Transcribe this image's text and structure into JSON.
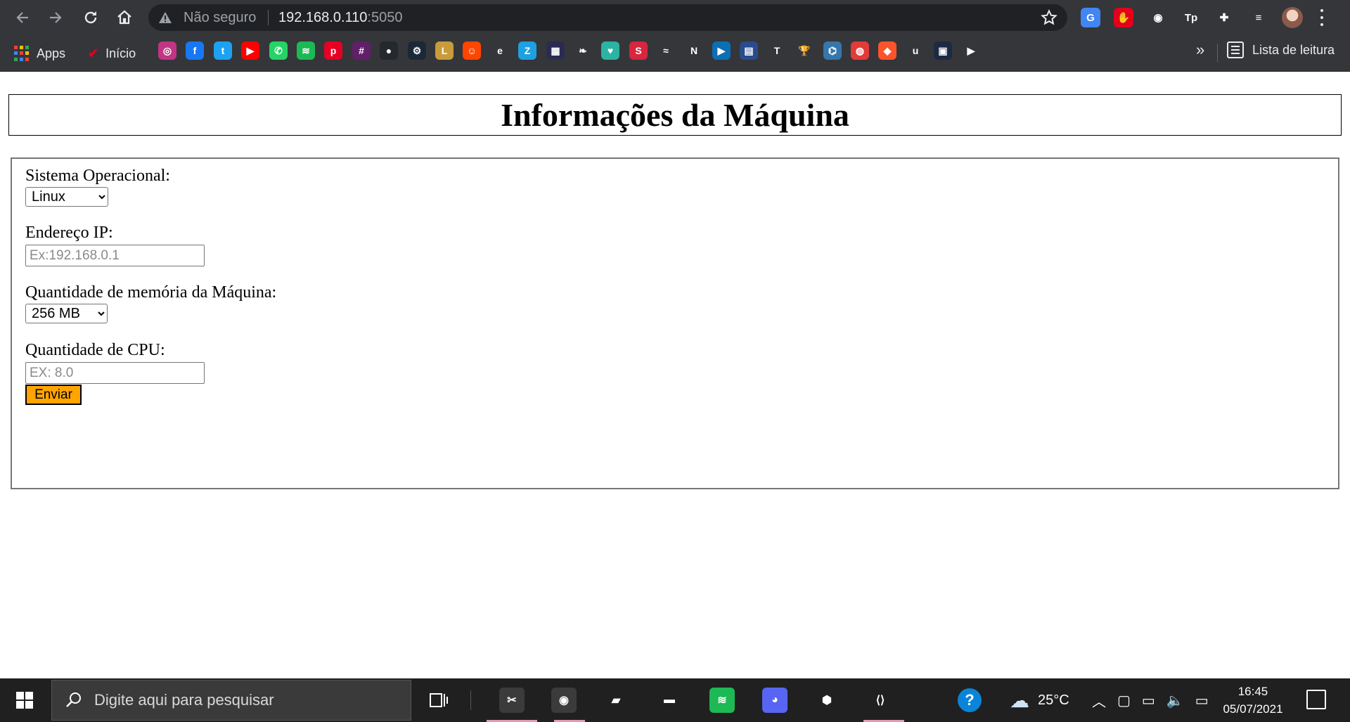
{
  "browser": {
    "security_label": "Não seguro",
    "url_host": "192.168.0.110",
    "url_port": ":5050",
    "bookmarks": {
      "apps_label": "Apps",
      "inicio_label": "Início",
      "more_label": "»",
      "reading_list_label": "Lista de leitura",
      "icons": [
        {
          "name": "instagram-icon",
          "color": "#c13584",
          "glyph": "◎"
        },
        {
          "name": "facebook-icon",
          "color": "#1877f2",
          "glyph": "f"
        },
        {
          "name": "twitter-icon",
          "color": "#1da1f2",
          "glyph": "t"
        },
        {
          "name": "youtube-icon",
          "color": "#ff0000",
          "glyph": "▶"
        },
        {
          "name": "whatsapp-icon",
          "color": "#25d366",
          "glyph": "✆"
        },
        {
          "name": "spotify-icon",
          "color": "#1db954",
          "glyph": "≋"
        },
        {
          "name": "pinterest-icon",
          "color": "#e60023",
          "glyph": "p"
        },
        {
          "name": "slack-icon",
          "color": "#611f69",
          "glyph": "#"
        },
        {
          "name": "github-icon",
          "color": "#24292e",
          "glyph": "●"
        },
        {
          "name": "steam-icon",
          "color": "#1b2838",
          "glyph": "⚙"
        },
        {
          "name": "league-icon",
          "color": "#c89b3c",
          "glyph": "L"
        },
        {
          "name": "reddit-icon",
          "color": "#ff4500",
          "glyph": "☺"
        },
        {
          "name": "e-icon",
          "color": "#35363a",
          "glyph": "e"
        },
        {
          "name": "z-icon",
          "color": "#1ea0e1",
          "glyph": "Z"
        },
        {
          "name": "game-icon",
          "color": "#2b2b50",
          "glyph": "▦"
        },
        {
          "name": "leaf-icon",
          "color": "#35363a",
          "glyph": "❧"
        },
        {
          "name": "heart-icon",
          "color": "#2bb3a3",
          "glyph": "♥"
        },
        {
          "name": "s-icon",
          "color": "#d7263d",
          "glyph": "S"
        },
        {
          "name": "swirl-icon",
          "color": "#35363a",
          "glyph": "≈"
        },
        {
          "name": "netflix-icon",
          "color": "#35363a",
          "glyph": "N"
        },
        {
          "name": "play-icon",
          "color": "#0b6fb3",
          "glyph": "▶"
        },
        {
          "name": "book-icon",
          "color": "#2a4b8d",
          "glyph": "▤"
        },
        {
          "name": "t-icon",
          "color": "#35363a",
          "glyph": "T"
        },
        {
          "name": "trophy-icon",
          "color": "#35363a",
          "glyph": "🏆"
        },
        {
          "name": "python-icon",
          "color": "#3776ab",
          "glyph": "⌬"
        },
        {
          "name": "popcorn-icon",
          "color": "#e33a3a",
          "glyph": "◍"
        },
        {
          "name": "brave-icon",
          "color": "#fb542b",
          "glyph": "◆"
        },
        {
          "name": "u-icon",
          "color": "#35363a",
          "glyph": "u"
        },
        {
          "name": "square-icon",
          "color": "#1d2a44",
          "glyph": "▣"
        },
        {
          "name": "plex-icon",
          "color": "#35363a",
          "glyph": "▶"
        }
      ]
    },
    "extensions": [
      {
        "name": "google-translate-icon",
        "color": "#4285f4",
        "glyph": "G"
      },
      {
        "name": "adblock-hand-icon",
        "color": "#e3001b",
        "glyph": "✋"
      },
      {
        "name": "glasses-icon",
        "color": "#35363a",
        "glyph": "◉"
      },
      {
        "name": "tp-icon",
        "color": "#35363a",
        "glyph": "Tp"
      },
      {
        "name": "puzzle-icon",
        "color": "#35363a",
        "glyph": "✚"
      },
      {
        "name": "playlist-icon",
        "color": "#35363a",
        "glyph": "≡"
      }
    ]
  },
  "page": {
    "title": "Informações da Máquina",
    "form": {
      "os_label": "Sistema Operacional:",
      "os_selected": "Linux",
      "ip_label": "Endereço IP:",
      "ip_placeholder": "Ex:192.168.0.1",
      "memory_label": "Quantidade de memória da Máquina:",
      "memory_selected": "256 MB",
      "cpu_label": "Quantidade de CPU:",
      "cpu_placeholder": "EX: 8.0",
      "submit_label": "Enviar"
    }
  },
  "taskbar": {
    "search_placeholder": "Digite aqui para pesquisar",
    "temperature": "25°C",
    "time": "16:45",
    "date": "05/07/2021",
    "apps": [
      {
        "name": "snip-sketch-icon",
        "color": "#3b3b3b",
        "glyph": "✂"
      },
      {
        "name": "chrome-icon",
        "color": "#3b3b3b",
        "glyph": "◉"
      },
      {
        "name": "notes-icon",
        "color": "#202020",
        "glyph": "▰"
      },
      {
        "name": "file-explorer-icon",
        "color": "#202020",
        "glyph": "▬"
      },
      {
        "name": "spotify-taskbar-icon",
        "color": "#1db954",
        "glyph": "≋"
      },
      {
        "name": "discord-icon",
        "color": "#5865f2",
        "glyph": "◕"
      },
      {
        "name": "virtualbox-icon",
        "color": "#202020",
        "glyph": "⬢"
      },
      {
        "name": "vscode-icon",
        "color": "#202020",
        "glyph": "⟨⟩"
      }
    ]
  }
}
